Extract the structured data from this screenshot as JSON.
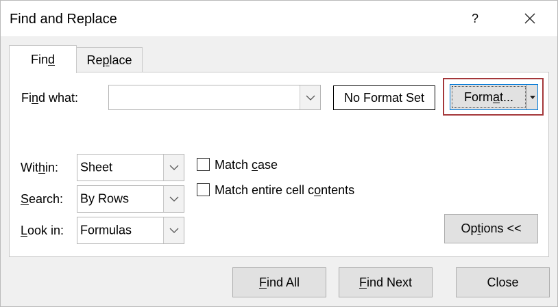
{
  "window": {
    "title": "Find and Replace",
    "help": "?",
    "close_icon": "close-icon"
  },
  "tabs": [
    {
      "pre": "Fin",
      "key": "d",
      "post": "",
      "active": true
    },
    {
      "pre": "Re",
      "key": "p",
      "post": "lace",
      "active": false
    }
  ],
  "find_what": {
    "label_pre": "Fi",
    "label_key": "n",
    "label_post": "d what:",
    "value": ""
  },
  "format_status": "No Format Set",
  "format_button": {
    "pre": "Form",
    "key": "a",
    "post": "t..."
  },
  "within": {
    "label_pre": "Wit",
    "label_key": "h",
    "label_post": "in:",
    "value": "Sheet"
  },
  "search": {
    "label_pre": "",
    "label_key": "S",
    "label_post": "earch:",
    "value": "By Rows"
  },
  "look_in": {
    "label_pre": "",
    "label_key": "L",
    "label_post": "ook in:",
    "value": "Formulas"
  },
  "match_case": {
    "pre": "Match ",
    "key": "c",
    "post": "ase",
    "checked": false
  },
  "match_entire": {
    "pre": "Match entire cell c",
    "key": "o",
    "post": "ntents",
    "checked": false
  },
  "options_button": {
    "pre": "Op",
    "key": "t",
    "post": "ions <<"
  },
  "find_all_button": {
    "pre": "",
    "key": "F",
    "post": "ind All"
  },
  "find_next_button": {
    "pre": "",
    "key": "F",
    "post": "ind Next"
  },
  "close_button": "Close",
  "colors": {
    "highlight": "#a4373a",
    "focus": "#0078d7"
  }
}
